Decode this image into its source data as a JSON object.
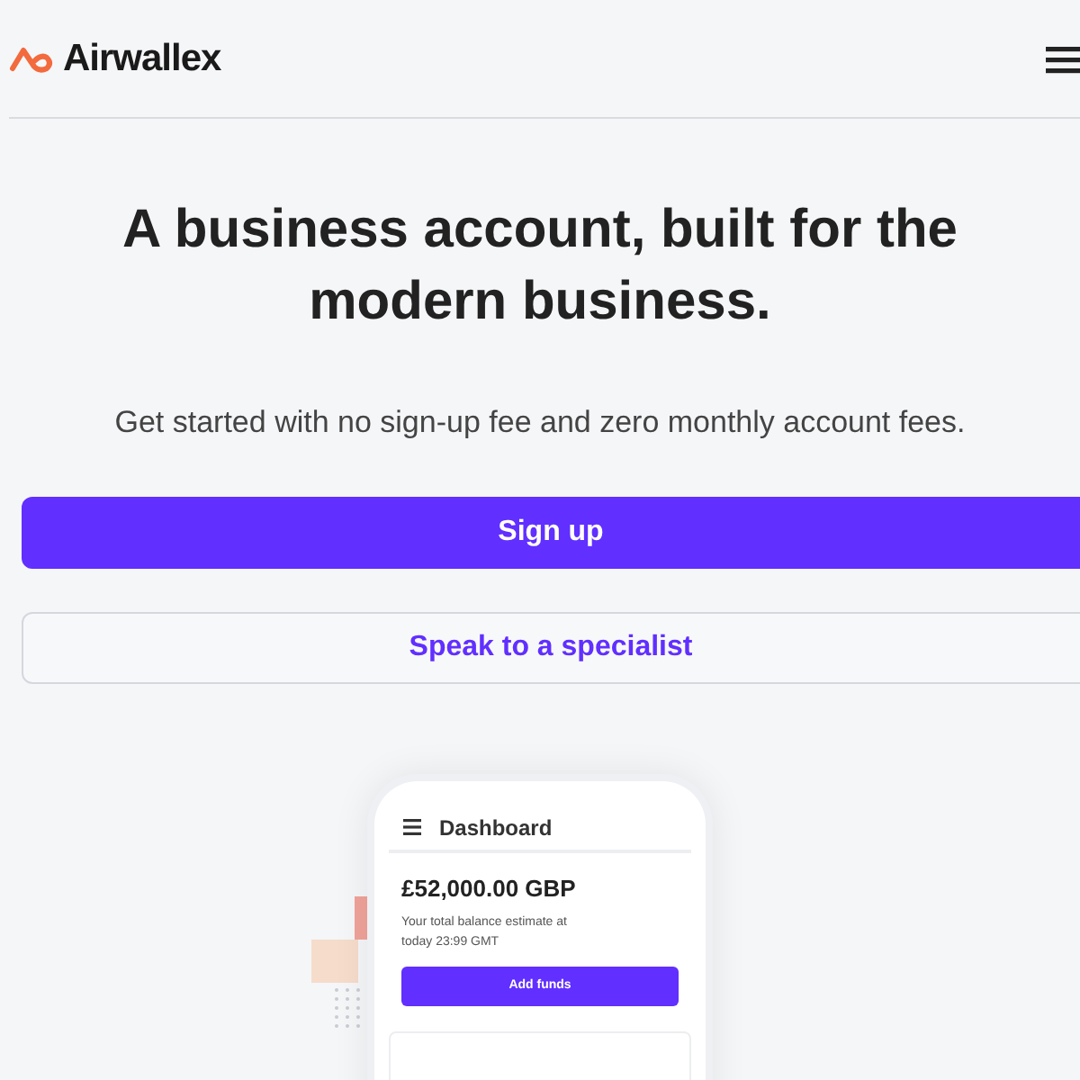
{
  "header": {
    "logo": "Airwallex"
  },
  "hero": {
    "title": "A business account, built for the modern business.",
    "subtitle": "Get started with no sign-up fee and zero monthly account fees.",
    "primary_button": "Sign up",
    "secondary_button": "Speak to a specialist"
  },
  "phone": {
    "title": "Dashboard",
    "balance": "£52,000.00 GBP",
    "balance_note": "Your total balance estimate at today 23:99 GMT",
    "button": "Add funds"
  }
}
